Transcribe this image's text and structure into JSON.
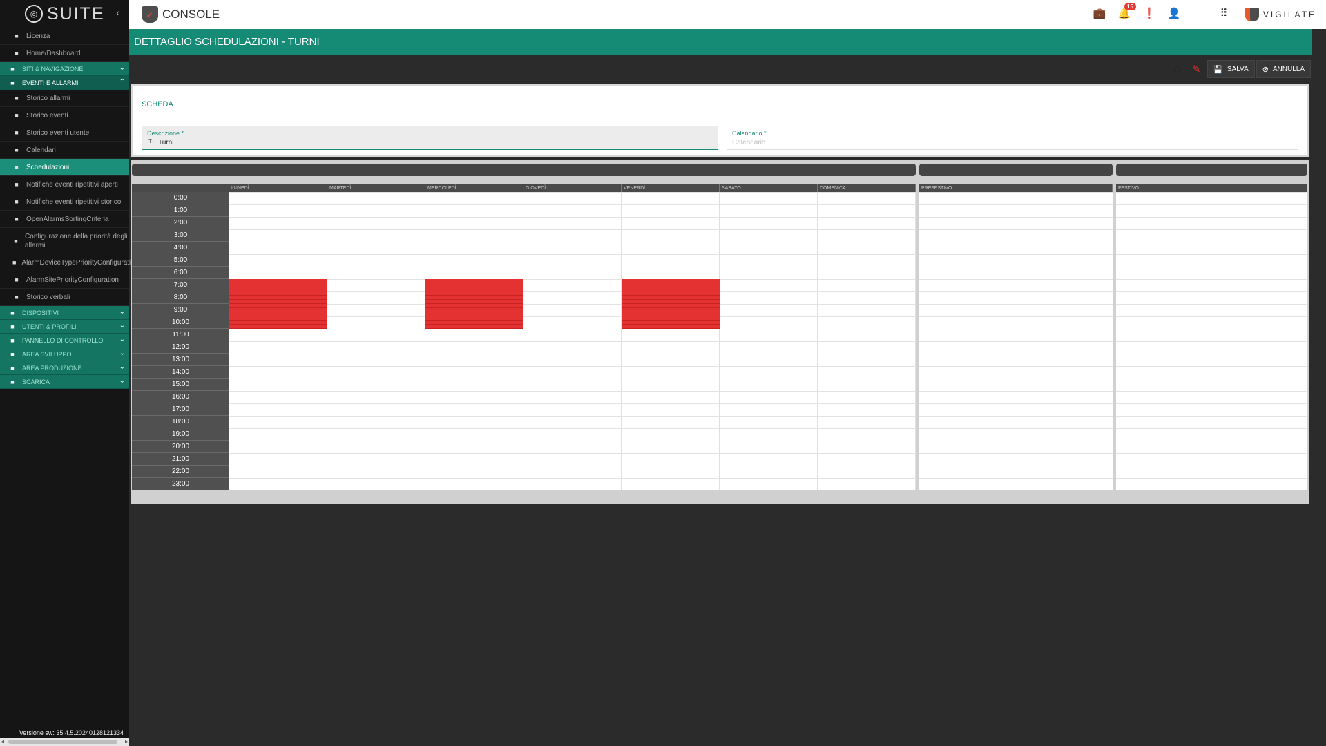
{
  "sidebar": {
    "logo_text": "SUITE",
    "items": [
      {
        "type": "item",
        "label": "Licenza",
        "icon": "id-card-icon"
      },
      {
        "type": "item",
        "label": "Home/Dashboard",
        "icon": "home-icon"
      },
      {
        "type": "group",
        "label": "SITI & NAVIGAZIONE",
        "icon": "home-icon",
        "open": false
      },
      {
        "type": "group",
        "label": "EVENTI E ALLARMI",
        "icon": "events-icon",
        "open": true
      },
      {
        "type": "item",
        "label": "Storico allarmi",
        "icon": "bell-icon"
      },
      {
        "type": "item",
        "label": "Storico eventi",
        "icon": "clipboard-icon"
      },
      {
        "type": "item",
        "label": "Storico eventi utente",
        "icon": "user-list-icon"
      },
      {
        "type": "item",
        "label": "Calendari",
        "icon": "calendar-icon"
      },
      {
        "type": "item",
        "label": "Schedulazioni",
        "icon": "schedule-icon",
        "active": true
      },
      {
        "type": "item",
        "label": "Notifiche eventi ripetitivi aperti",
        "icon": "list-icon"
      },
      {
        "type": "item",
        "label": "Notifiche eventi ripetitivi storico",
        "icon": "history-icon"
      },
      {
        "type": "item",
        "label": "OpenAlarmsSortingCriteria",
        "icon": "gear-icon"
      },
      {
        "type": "item",
        "label": "Configurazione della priorità degli allarmi",
        "icon": "gear-icon",
        "tall": true
      },
      {
        "type": "item",
        "label": "AlarmDeviceTypePriorityConfiguratio",
        "icon": "gear-icon"
      },
      {
        "type": "item",
        "label": "AlarmSitePriorityConfiguration",
        "icon": "gear-icon"
      },
      {
        "type": "item",
        "label": "Storico verbali",
        "icon": "report-icon"
      },
      {
        "type": "group",
        "label": "DISPOSITIVI",
        "icon": "devices-icon",
        "open": false
      },
      {
        "type": "group",
        "label": "UTENTI & PROFILI",
        "icon": "users-icon",
        "open": false
      },
      {
        "type": "group",
        "label": "PANNELLO DI CONTROLLO",
        "icon": "control-panel-icon",
        "open": false
      },
      {
        "type": "group",
        "label": "AREA SVILUPPO",
        "icon": "code-icon",
        "open": false
      },
      {
        "type": "group",
        "label": "AREA PRODUZIONE",
        "icon": "person-icon",
        "open": false
      },
      {
        "type": "group",
        "label": "SCARICA",
        "icon": "download-icon",
        "open": false
      }
    ],
    "version": "Versione sw: 35.4.5.20240128121334"
  },
  "topbar": {
    "app_name": "CONSOLE",
    "notification_count": "15",
    "right_brand": "VIGILATE",
    "icons": [
      "briefcase-icon",
      "bell-icon",
      "alert-icon",
      "account-icon",
      "flag-it-icon",
      "apps-grid-icon"
    ]
  },
  "page": {
    "title": "DETTAGLIO SCHEDULAZIONI - TURNI"
  },
  "toolbar": {
    "save_label": "SALVA",
    "cancel_label": "ANNULLA"
  },
  "form": {
    "section_title": "SCHEDA",
    "description_label": "Descrizione *",
    "description_value": "Turni",
    "calendar_label": "Calendario *",
    "calendar_placeholder": "Calendario"
  },
  "schedule": {
    "hours": [
      "0:00",
      "1:00",
      "2:00",
      "3:00",
      "4:00",
      "5:00",
      "6:00",
      "7:00",
      "8:00",
      "9:00",
      "10:00",
      "11:00",
      "12:00",
      "13:00",
      "14:00",
      "15:00",
      "16:00",
      "17:00",
      "18:00",
      "19:00",
      "20:00",
      "21:00",
      "22:00",
      "23:00"
    ],
    "days": [
      "LUNEDÌ",
      "MARTEDÌ",
      "MERCOLEDÌ",
      "GIOVEDÌ",
      "VENERDÌ",
      "SABATO",
      "DOMENICA"
    ],
    "prefestivo_label": "PREFESTIVO",
    "festivo_label": "FESTIVO",
    "active_color": "#e43232",
    "active_slots": [
      {
        "day": "LUNEDÌ",
        "from": "7:00",
        "to": "10:59"
      },
      {
        "day": "MERCOLEDÌ",
        "from": "7:00",
        "to": "10:59"
      },
      {
        "day": "VENERDÌ",
        "from": "7:00",
        "to": "10:59"
      }
    ]
  },
  "colors": {
    "accent": "#158a75",
    "sidebar_bg": "#151515",
    "page_bg": "#2b2b2b"
  }
}
